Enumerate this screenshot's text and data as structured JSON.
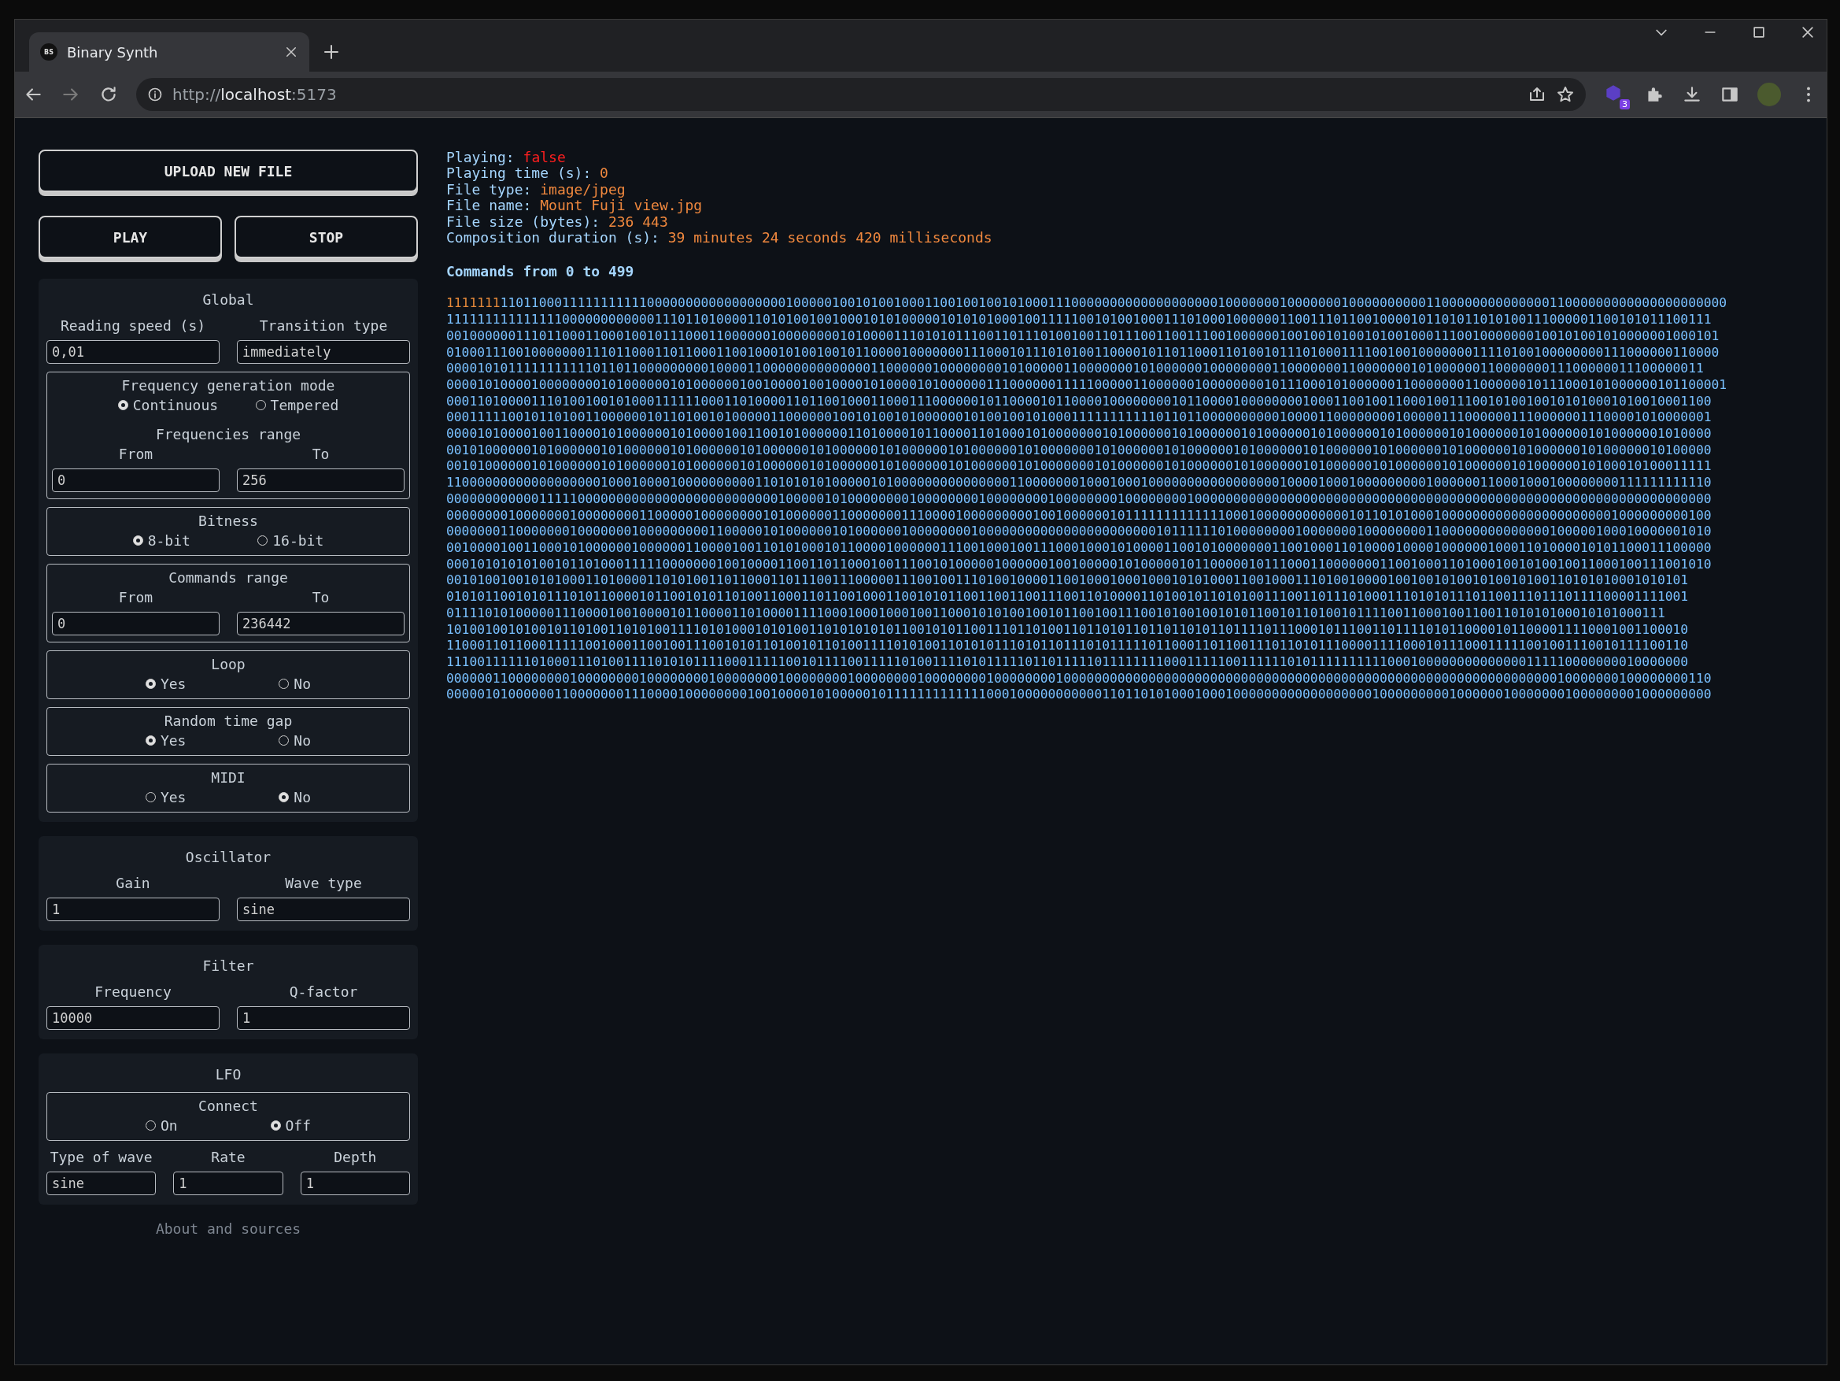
{
  "browser": {
    "tab_title": "Binary Synth",
    "tab_icon_text": "BS",
    "url_scheme": "http://",
    "url_host": "localhost",
    "url_port": ":5173",
    "extension_badge": "3"
  },
  "sidebar": {
    "upload_button": "UPLOAD NEW FILE",
    "play_button": "PLAY",
    "stop_button": "STOP",
    "sections": [
      {
        "title": "Global",
        "items": [
          {
            "kind": "fields",
            "fields": [
              {
                "label": "Reading speed (s)",
                "value": "0,01"
              },
              {
                "label": "Transition type",
                "value": "immediately"
              }
            ]
          },
          {
            "kind": "box",
            "title": "Frequency generation mode",
            "options": [
              {
                "label": "Continuous",
                "selected": true
              },
              {
                "label": "Tempered",
                "selected": false
              }
            ],
            "subtitle": "Frequencies range",
            "fields": [
              {
                "label": "From",
                "value": "0"
              },
              {
                "label": "To",
                "value": "256"
              }
            ]
          },
          {
            "kind": "box",
            "title": "Bitness",
            "options": [
              {
                "label": "8-bit",
                "selected": true
              },
              {
                "label": "16-bit",
                "selected": false
              }
            ]
          },
          {
            "kind": "box",
            "title": "Commands range",
            "fields": [
              {
                "label": "From",
                "value": "0"
              },
              {
                "label": "To",
                "value": "236442"
              }
            ]
          },
          {
            "kind": "box",
            "title": "Loop",
            "options": [
              {
                "label": "Yes",
                "selected": true
              },
              {
                "label": "No",
                "selected": false
              }
            ]
          },
          {
            "kind": "box",
            "title": "Random time gap",
            "options": [
              {
                "label": "Yes",
                "selected": true
              },
              {
                "label": "No",
                "selected": false
              }
            ]
          },
          {
            "kind": "box",
            "title": "MIDI",
            "options": [
              {
                "label": "Yes",
                "selected": false
              },
              {
                "label": "No",
                "selected": true
              }
            ]
          }
        ]
      },
      {
        "title": "Oscillator",
        "items": [
          {
            "kind": "fields",
            "fields": [
              {
                "label": "Gain",
                "value": "1"
              },
              {
                "label": "Wave type",
                "value": "sine"
              }
            ]
          }
        ]
      },
      {
        "title": "Filter",
        "items": [
          {
            "kind": "fields",
            "fields": [
              {
                "label": "Frequency",
                "value": "10000"
              },
              {
                "label": "Q-factor",
                "value": "1"
              }
            ]
          }
        ]
      },
      {
        "title": "LFO",
        "items": [
          {
            "kind": "box",
            "title": "Connect",
            "options": [
              {
                "label": "On",
                "selected": false
              },
              {
                "label": "Off",
                "selected": true
              }
            ]
          },
          {
            "kind": "fields",
            "fields": [
              {
                "label": "Type of wave",
                "value": "sine"
              },
              {
                "label": "Rate",
                "value": "1"
              },
              {
                "label": "Depth",
                "value": "1"
              }
            ]
          }
        ]
      }
    ],
    "footer_link": "About and sources"
  },
  "info": {
    "lines": [
      {
        "label": "Playing:",
        "value": "false",
        "kind": "boolean"
      },
      {
        "label": "Playing time (s):",
        "value": "0",
        "kind": "text"
      },
      {
        "label": "File type:",
        "value": "image/jpeg",
        "kind": "text"
      },
      {
        "label": "File name:",
        "value": "Mount Fuji view.jpg",
        "kind": "text"
      },
      {
        "label": "File size (bytes):",
        "value": "236 443",
        "kind": "text"
      },
      {
        "label": "Composition duration (s):",
        "value": "39 minutes 24 seconds 420 milliseconds",
        "kind": "text"
      }
    ],
    "commands_heading": "Commands from 0 to 499"
  },
  "binary": {
    "highlighted": "1111111",
    "lines": [
      "110110001111111111100000000000000000010000010010100100011001001001010001110000000000000000000100000001000000010000000000110000000000000011000000000000000000000",
      "11111111111111100000000000011101101000011010100100100010101000001010101000100111110010100100011101000100000011001110110010000101101011010100111000001100101011100111",
      "001000000111011000110001001011100011000000100000000101000011101010111001101110100100110111001100111001000000100100101001010010001110010000000100101001010000001000101",
      "010001110010000000111011000110110001100100010100100101100001000000011100010111010100110000101101100011010010111010001111001001000000011110100100000000111000000110000",
      "0000101011111111111011011000000000100001100000000000000110000001000000001010000011000000010100000010000000011000000011000000010100000011000000011100000011100000011",
      "0000101000010000000010100000010100000010010000100100001010000101000000111000000111110000011000000100000000101110001010000001100000001100000010111000101000000101100001",
      "00011010000111010010010100011111100011010000110110010001100011100000010110000101100001000000001011000010000000010001100100110001001110010100100101010001010010001100",
      "00011111001011010011000000101101001010000011000000100101001010000001010010010100011111111111011011000000000010000110000000010000011100000011100000011100001010000001",
      "00001010000100110000101000000101000010011001010000001101000010110000110100010100000001010000001010000001010000001010000001010000001010000001010000001010000001010000",
      "00101000000101000000101000000101000000101000000101000000101000000101000000101000000010100000010100000010100000010100000010100000010100000010100000010100000010100000",
      "00101000000101000000101000000101000000101000000101000000101000000101000000101000000010100000010100000010100000010100000010100000010100000010100000010100010100011111",
      "11000000000000000000100010000100000000001101010101000001010000000000000001100000001000100010000000000000000010000100010000000001000000110001000100000000111111111110",
      "00000000000011111000000000000000000000000001000001010000000010000000010000000010000000010000000010000000000000000000000000000000000000000000000000000000000000000000",
      "00000000100000001000000001100000100000000101000000110000000111000010000000001001000000101111111111111000100000000000010110101000100000000000000000000001000000000100",
      "00000001100000001000000010000000001100000101000000101000000100000000100000000000000000000000101111110100000000100000001000000001100000000000000100000100010000001010",
      "00100001001100010100000010000001100001001101010001011000010000001110010001001110001000101000011001010000000110010001101000010000100000010001101000010101100011100000",
      "00010101010100101101000111110000000100100001100110110001001110010100000100000010010000010100000101100000101110001100000001100100011010001001010010011000100111001010",
      "00101001001010100011010000110101001101100011011100111000001110010011101001000011001000100010001010100011001000111010010000100100101001010010100110101010001010101",
      "01010110010101110101100001011001010110100110001101100100011001010110011001100111001101000011010010110101001110011011101000111010101110110011101110111100001111001",
      "01111010100000111000010010000101100001101000011110001000100010011000101010010010110010011100101001001010110010110100101111001100010011001101010100010101000111",
      "10100100101001011010011010100111101010001010100110101010101100101011001110110100110110101101101101011011110111000101110011011110101100001011000011110001001100010",
      "11000110110001111100100011001001110010101101001011010011110101001101010111010110111010111110110001101100111011010111000011110001011100011111001001110010111100110",
      "11100111111010001110100111101010111100011111001011110011111010011110101111101101111101111111100011111001111110101111111111000100000000000000111110000000010000000",
      "00000011000000001000000001000000001000000001000000001000000001000000001000000001000000000000000000000000000000000000000000000000000000000000000010000000100000000110",
      "00000101000000110000000111000010000000010010000101000001011111111111110001000000000001101101010001000100000000000000000010000000001000000100000001000000001000000000"
    ]
  }
}
